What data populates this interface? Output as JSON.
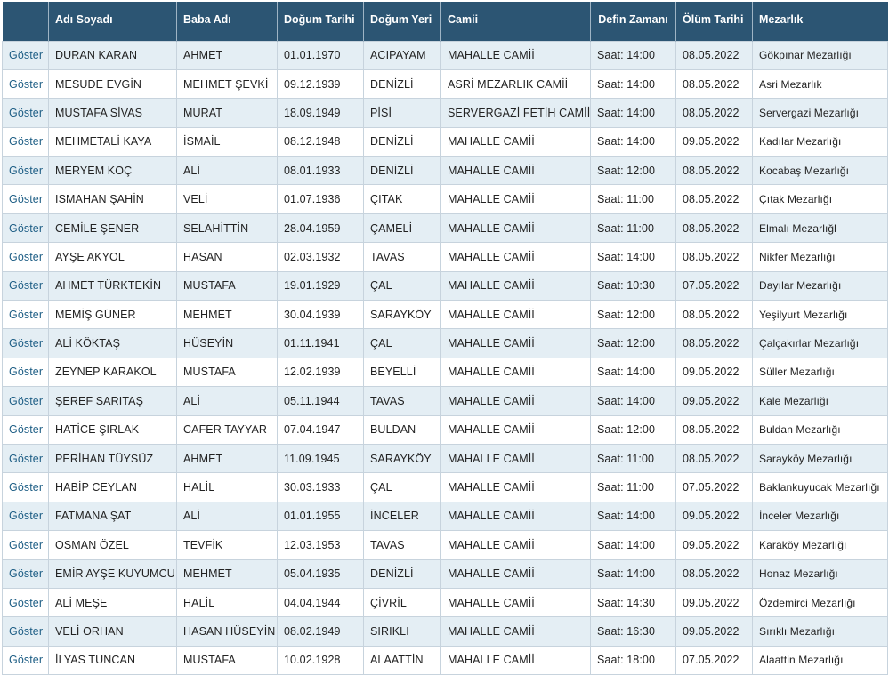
{
  "table": {
    "headers": {
      "action": "",
      "name": "Adı Soyadı",
      "father": "Baba Adı",
      "birth_date": "Doğum Tarihi",
      "birth_place": "Doğum Yeri",
      "mosque": "Camii",
      "burial_time": "Defin Zamanı",
      "death_date": "Ölüm Tarihi",
      "cemetery": "Mezarlık"
    },
    "rows": [
      {
        "action": "Göster",
        "name": "DURAN KARAN",
        "father": "AHMET",
        "birth_date": "01.01.1970",
        "birth_place": "ACIPAYAM",
        "mosque": "MAHALLE CAMİİ",
        "burial_time": "Saat: 14:00",
        "death_date": "08.05.2022",
        "cemetery": "Gökpınar Mezarlığı"
      },
      {
        "action": "Göster",
        "name": "MESUDE EVGİN",
        "father": "MEHMET ŞEVKİ",
        "birth_date": "09.12.1939",
        "birth_place": "DENİZLİ",
        "mosque": "ASRİ MEZARLIK CAMİİ",
        "burial_time": "Saat: 14:00",
        "death_date": "08.05.2022",
        "cemetery": "Asri Mezarlık"
      },
      {
        "action": "Göster",
        "name": "MUSTAFA SİVAS",
        "father": "MURAT",
        "birth_date": "18.09.1949",
        "birth_place": "PİSİ",
        "mosque": "SERVERGAZİ FETİH CAMİİ",
        "burial_time": "Saat: 14:00",
        "death_date": "08.05.2022",
        "cemetery": "Servergazi Mezarlığı"
      },
      {
        "action": "Göster",
        "name": "MEHMETALİ KAYA",
        "father": "İSMAİL",
        "birth_date": "08.12.1948",
        "birth_place": "DENİZLİ",
        "mosque": "MAHALLE CAMİİ",
        "burial_time": "Saat: 14:00",
        "death_date": "09.05.2022",
        "cemetery": "Kadılar Mezarlığı"
      },
      {
        "action": "Göster",
        "name": "MERYEM KOÇ",
        "father": "ALİ",
        "birth_date": "08.01.1933",
        "birth_place": "DENİZLİ",
        "mosque": "MAHALLE CAMİİ",
        "burial_time": "Saat: 12:00",
        "death_date": "08.05.2022",
        "cemetery": "Kocabaş Mezarlığı"
      },
      {
        "action": "Göster",
        "name": "ISMAHAN ŞAHİN",
        "father": "VELİ",
        "birth_date": "01.07.1936",
        "birth_place": "ÇITAK",
        "mosque": "MAHALLE CAMİİ",
        "burial_time": "Saat: 11:00",
        "death_date": "08.05.2022",
        "cemetery": "Çıtak Mezarlığı"
      },
      {
        "action": "Göster",
        "name": "CEMİLE ŞENER",
        "father": "SELAHİTTİN",
        "birth_date": "28.04.1959",
        "birth_place": "ÇAMELİ",
        "mosque": "MAHALLE CAMİİ",
        "burial_time": "Saat: 11:00",
        "death_date": "08.05.2022",
        "cemetery": "Elmalı Mezarlığl"
      },
      {
        "action": "Göster",
        "name": "AYŞE AKYOL",
        "father": "HASAN",
        "birth_date": "02.03.1932",
        "birth_place": "TAVAS",
        "mosque": "MAHALLE CAMİİ",
        "burial_time": "Saat: 14:00",
        "death_date": "08.05.2022",
        "cemetery": "Nikfer Mezarlığı"
      },
      {
        "action": "Göster",
        "name": "AHMET TÜRKTEKİN",
        "father": "MUSTAFA",
        "birth_date": "19.01.1929",
        "birth_place": "ÇAL",
        "mosque": "MAHALLE CAMİİ",
        "burial_time": "Saat: 10:30",
        "death_date": "07.05.2022",
        "cemetery": "Dayılar Mezarlığı"
      },
      {
        "action": "Göster",
        "name": "MEMİŞ GÜNER",
        "father": "MEHMET",
        "birth_date": "30.04.1939",
        "birth_place": "SARAYKÖY",
        "mosque": "MAHALLE CAMİİ",
        "burial_time": "Saat: 12:00",
        "death_date": "08.05.2022",
        "cemetery": "Yeşilyurt Mezarlığı"
      },
      {
        "action": "Göster",
        "name": "ALİ KÖKTAŞ",
        "father": "HÜSEYİN",
        "birth_date": "01.11.1941",
        "birth_place": "ÇAL",
        "mosque": "MAHALLE CAMİİ",
        "burial_time": "Saat: 12:00",
        "death_date": "08.05.2022",
        "cemetery": "Çalçakırlar Mezarlığı"
      },
      {
        "action": "Göster",
        "name": "ZEYNEP KARAKOL",
        "father": "MUSTAFA",
        "birth_date": "12.02.1939",
        "birth_place": "BEYELLİ",
        "mosque": "MAHALLE CAMİİ",
        "burial_time": "Saat: 14:00",
        "death_date": "09.05.2022",
        "cemetery": "Süller Mezarlığı"
      },
      {
        "action": "Göster",
        "name": "ŞEREF SARITAŞ",
        "father": "ALİ",
        "birth_date": "05.11.1944",
        "birth_place": "TAVAS",
        "mosque": "MAHALLE CAMİİ",
        "burial_time": "Saat: 14:00",
        "death_date": "09.05.2022",
        "cemetery": "Kale Mezarlığı"
      },
      {
        "action": "Göster",
        "name": "HATİCE ŞIRLAK",
        "father": "CAFER TAYYAR",
        "birth_date": "07.04.1947",
        "birth_place": "BULDAN",
        "mosque": "MAHALLE CAMİİ",
        "burial_time": "Saat: 12:00",
        "death_date": "08.05.2022",
        "cemetery": "Buldan Mezarlığı"
      },
      {
        "action": "Göster",
        "name": "PERİHAN TÜYSÜZ",
        "father": "AHMET",
        "birth_date": "11.09.1945",
        "birth_place": "SARAYKÖY",
        "mosque": "MAHALLE CAMİİ",
        "burial_time": "Saat: 11:00",
        "death_date": "08.05.2022",
        "cemetery": "Sarayköy Mezarlığı"
      },
      {
        "action": "Göster",
        "name": "HABİP CEYLAN",
        "father": "HALİL",
        "birth_date": "30.03.1933",
        "birth_place": "ÇAL",
        "mosque": "MAHALLE CAMİİ",
        "burial_time": "Saat: 11:00",
        "death_date": "07.05.2022",
        "cemetery": "Baklankuyucak Mezarlığı"
      },
      {
        "action": "Göster",
        "name": "FATMANA ŞAT",
        "father": "ALİ",
        "birth_date": "01.01.1955",
        "birth_place": "İNCELER",
        "mosque": "MAHALLE CAMİİ",
        "burial_time": "Saat: 14:00",
        "death_date": "09.05.2022",
        "cemetery": "İnceler Mezarlığı"
      },
      {
        "action": "Göster",
        "name": "OSMAN ÖZEL",
        "father": "TEVFİK",
        "birth_date": "12.03.1953",
        "birth_place": "TAVAS",
        "mosque": "MAHALLE CAMİİ",
        "burial_time": "Saat: 14:00",
        "death_date": "09.05.2022",
        "cemetery": "Karaköy Mezarlığı"
      },
      {
        "action": "Göster",
        "name": "EMİR AYŞE KUYUMCU",
        "father": "MEHMET",
        "birth_date": "05.04.1935",
        "birth_place": "DENİZLİ",
        "mosque": "MAHALLE CAMİİ",
        "burial_time": "Saat: 14:00",
        "death_date": "08.05.2022",
        "cemetery": "Honaz Mezarlığı"
      },
      {
        "action": "Göster",
        "name": "ALİ MEŞE",
        "father": "HALİL",
        "birth_date": "04.04.1944",
        "birth_place": "ÇİVRİL",
        "mosque": "MAHALLE CAMİİ",
        "burial_time": "Saat: 14:30",
        "death_date": "09.05.2022",
        "cemetery": "Özdemirci Mezarlığı"
      },
      {
        "action": "Göster",
        "name": "VELİ ORHAN",
        "father": "HASAN HÜSEYİN",
        "birth_date": "08.02.1949",
        "birth_place": "SIRIKLI",
        "mosque": "MAHALLE CAMİİ",
        "burial_time": "Saat: 16:30",
        "death_date": "09.05.2022",
        "cemetery": "Sırıklı Mezarlığı"
      },
      {
        "action": "Göster",
        "name": "İLYAS TUNCAN",
        "father": "MUSTAFA",
        "birth_date": "10.02.1928",
        "birth_place": "ALAATTİN",
        "mosque": "MAHALLE CAMİİ",
        "burial_time": "Saat: 18:00",
        "death_date": "07.05.2022",
        "cemetery": "Alaattin Mezarlığı"
      }
    ]
  },
  "colors": {
    "header_bg": "#2c5573",
    "header_text": "#ffffff",
    "row_alt_bg": "#e4eef4",
    "link": "#1f5f86"
  }
}
